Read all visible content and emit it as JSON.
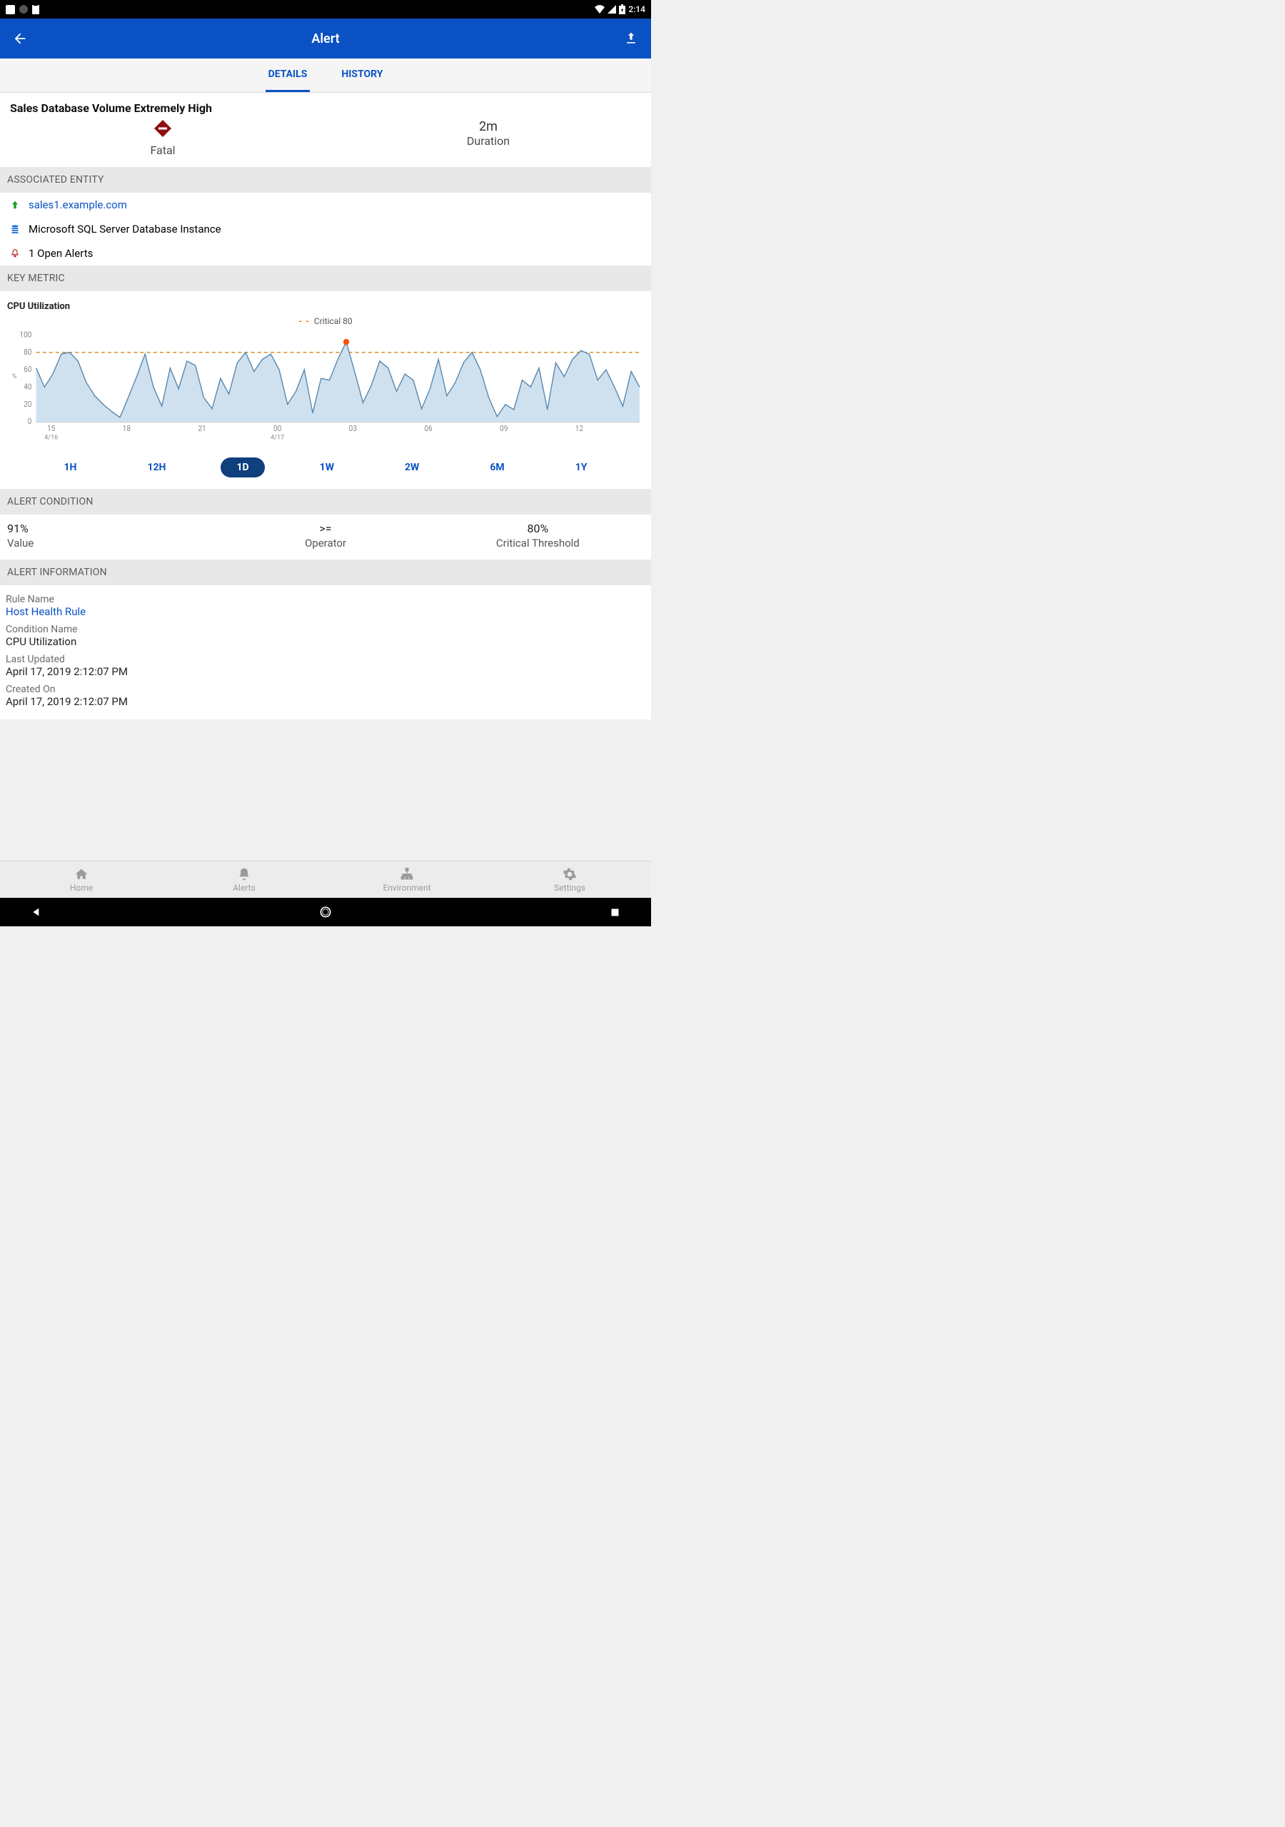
{
  "status_bar": {
    "time": "2:14"
  },
  "header": {
    "title": "Alert"
  },
  "tabs": [
    {
      "label": "DETAILS",
      "active": true
    },
    {
      "label": "HISTORY",
      "active": false
    }
  ],
  "alert": {
    "title": "Sales Database Volume Extremely High",
    "severity_label": "Fatal",
    "duration_value": "2m",
    "duration_label": "Duration"
  },
  "sections": {
    "associated_entity": "ASSOCIATED ENTITY",
    "key_metric": "KEY METRIC",
    "alert_condition": "ALERT CONDITION",
    "alert_information": "ALERT INFORMATION"
  },
  "entity": {
    "host": "sales1.example.com",
    "type": "Microsoft SQL Server Database Instance",
    "open_alerts": "1 Open Alerts"
  },
  "metric": {
    "title": "CPU Utilization",
    "legend_label": "Critical 80",
    "y_label": "%"
  },
  "ranges": [
    "1H",
    "12H",
    "1D",
    "1W",
    "2W",
    "6M",
    "1Y"
  ],
  "range_active_index": 2,
  "condition": {
    "value": "91%",
    "value_label": "Value",
    "operator": ">=",
    "operator_label": "Operator",
    "threshold": "80%",
    "threshold_label": "Critical Threshold"
  },
  "info": {
    "rule_name_label": "Rule Name",
    "rule_name": "Host Health Rule",
    "condition_name_label": "Condition Name",
    "condition_name": "CPU Utilization",
    "last_updated_label": "Last Updated",
    "last_updated": "April 17, 2019 2:12:07 PM",
    "created_on_label": "Created On",
    "created_on": "April 17, 2019 2:12:07 PM"
  },
  "bottom_nav": [
    "Home",
    "Alerts",
    "Environment",
    "Settings"
  ],
  "chart_data": {
    "type": "area",
    "title": "CPU Utilization",
    "ylabel": "%",
    "ylim": [
      0,
      100
    ],
    "threshold": {
      "label": "Critical 80",
      "value": 80
    },
    "x_ticks": [
      {
        "major": "15",
        "minor": "4/16"
      },
      {
        "major": "18"
      },
      {
        "major": "21"
      },
      {
        "major": "00",
        "minor": "4/17"
      },
      {
        "major": "03"
      },
      {
        "major": "06"
      },
      {
        "major": "09"
      },
      {
        "major": "12"
      }
    ],
    "y_ticks": [
      0,
      20,
      40,
      60,
      80,
      100
    ],
    "marker": {
      "x_index_approx": 37,
      "value": 92
    },
    "series": [
      {
        "name": "CPU Utilization",
        "values": [
          62,
          40,
          55,
          78,
          80,
          70,
          45,
          30,
          20,
          12,
          5,
          28,
          52,
          78,
          40,
          18,
          62,
          38,
          70,
          65,
          28,
          15,
          50,
          32,
          68,
          80,
          58,
          72,
          78,
          60,
          20,
          35,
          60,
          10,
          50,
          48,
          72,
          92,
          58,
          22,
          42,
          70,
          62,
          35,
          55,
          48,
          15,
          38,
          72,
          30,
          45,
          68,
          80,
          60,
          28,
          6,
          20,
          14,
          48,
          40,
          62,
          14,
          68,
          52,
          72,
          82,
          78,
          48,
          60,
          40,
          18,
          58,
          40
        ]
      }
    ]
  }
}
